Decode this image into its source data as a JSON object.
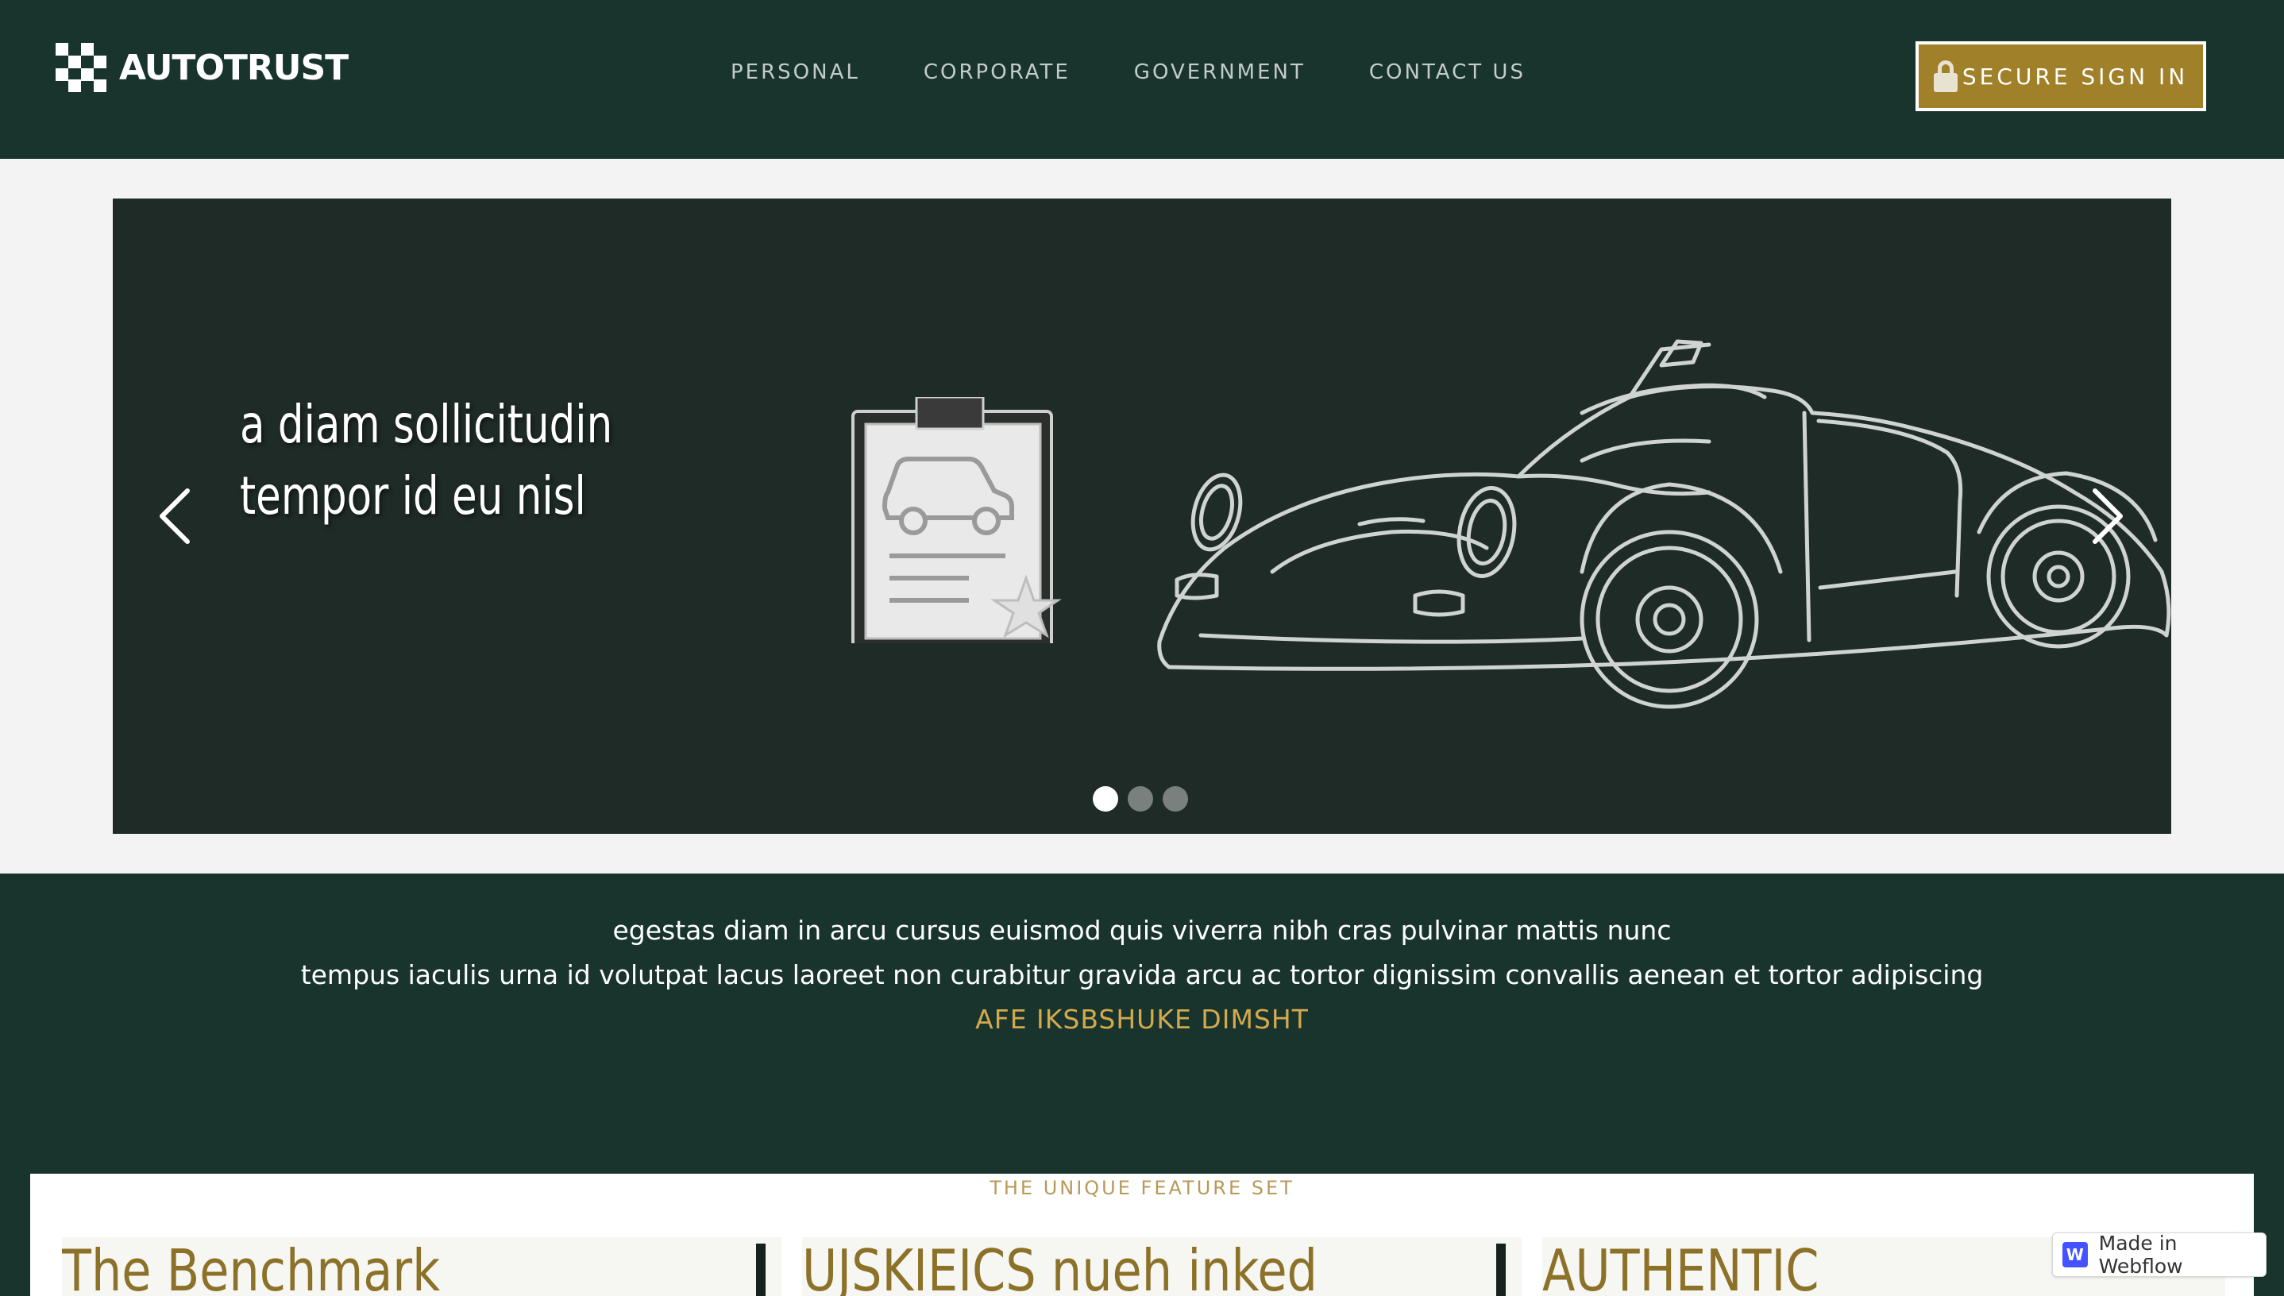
{
  "nav": {
    "logo_text": "AUTOTRUST",
    "items": [
      {
        "label": "PERSONAL"
      },
      {
        "label": "CORPORATE"
      },
      {
        "label": "GOVERNMENT"
      },
      {
        "label": "CONTACT US"
      }
    ],
    "signin_label": "SECURE SIGN IN"
  },
  "hero": {
    "heading_line1": "a diam sollicitudin",
    "heading_line2": "tempor id eu nisl",
    "slide_count": 3,
    "active_slide": 1
  },
  "band": {
    "line1": "egestas diam in arcu cursus euismod quis viverra nibh cras pulvinar mattis nunc",
    "line2": "tempus iaculis urna id volutpat lacus laoreet non curabitur gravida arcu ac tortor dignissim convallis aenean et tortor  adipiscing",
    "line3": "AFE IKSBSHUKE DIMSHT"
  },
  "features": {
    "label": "THE UNIQUE FEATURE SET",
    "cards": [
      {
        "title": "The Benchmark"
      },
      {
        "title": "UJSKIEICS nueh inked"
      },
      {
        "title": "AUTHENTIC"
      }
    ]
  },
  "webflow_badge": {
    "icon_letter": "W",
    "label": "Made in Webflow"
  },
  "colors": {
    "nav_bg": "#18342d",
    "accent_gold": "#a1802a",
    "slider_bg": "#1f2b27",
    "band_highlight": "#d4a94e"
  },
  "icons": [
    "logo-checker-icon",
    "lock-icon",
    "chevron-left-icon",
    "chevron-right-icon",
    "clipboard-car-icon",
    "car-sketch-icon",
    "webflow-icon"
  ]
}
